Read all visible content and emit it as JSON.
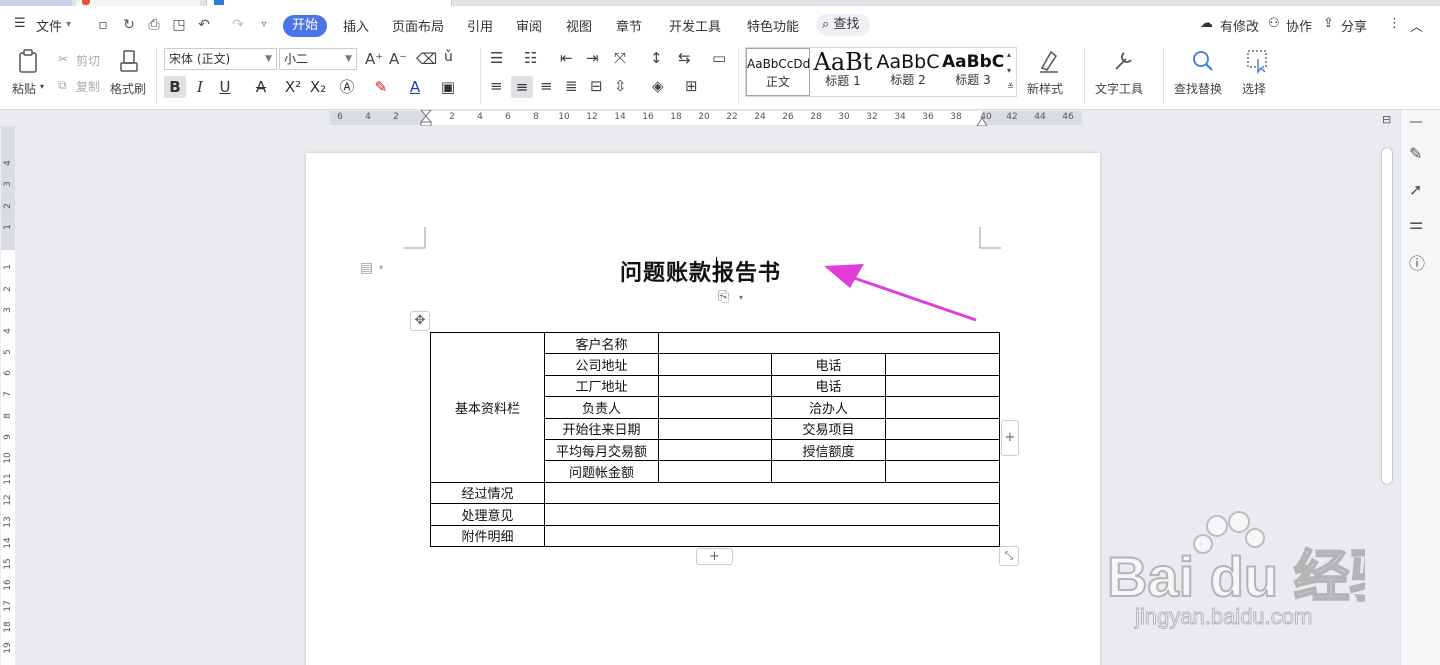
{
  "menubar": {
    "file_label": "文件",
    "tabs": [
      "开始",
      "插入",
      "页面布局",
      "引用",
      "审阅",
      "视图",
      "章节",
      "开发工具",
      "特色功能"
    ],
    "search_label": "查找",
    "right": {
      "changes": "有修改",
      "collab": "协作",
      "share": "分享"
    }
  },
  "ribbon": {
    "paste": "粘贴",
    "cut": "剪切",
    "copy": "复制",
    "format_painter": "格式刷",
    "font_name": "宋体 (正文)",
    "font_size": "小二",
    "styles": [
      {
        "sample": "AaBbCcDd",
        "label": "正文"
      },
      {
        "sample": "AaBt",
        "label": "标题 1"
      },
      {
        "sample": "AaBbC",
        "label": "标题 2"
      },
      {
        "sample": "AaBbC",
        "label": "标题 3"
      }
    ],
    "new_style": "新样式",
    "text_tools": "文字工具",
    "find_replace": "查找替换",
    "select": "选择"
  },
  "ruler": {
    "horizontal": [
      "6",
      "4",
      "2",
      "2",
      "4",
      "6",
      "8",
      "10",
      "12",
      "14",
      "16",
      "18",
      "20",
      "22",
      "24",
      "26",
      "28",
      "30",
      "32",
      "34",
      "36",
      "38",
      "40",
      "42",
      "44",
      "46"
    ],
    "vertical": [
      "4",
      "3",
      "2",
      "1",
      "1",
      "2",
      "3",
      "4",
      "5",
      "6",
      "7",
      "8",
      "9",
      "10",
      "11",
      "12",
      "13",
      "14",
      "15",
      "16",
      "17",
      "18",
      "19"
    ]
  },
  "document": {
    "title": "问题账款报告书",
    "table": {
      "section_label": "基本资料栏",
      "rows": [
        {
          "label": "客户名称"
        },
        {
          "label": "公司地址",
          "right_label": "电话"
        },
        {
          "label": "工厂地址",
          "right_label": "电话"
        },
        {
          "label": "负责人",
          "right_label": "洽办人"
        },
        {
          "label": "开始往来日期",
          "right_label": "交易项目"
        },
        {
          "label": "平均每月交易额",
          "right_label": "授信额度"
        },
        {
          "label": "问题帐金额"
        }
      ],
      "footer_rows": [
        "经过情况",
        "处理意见",
        "附件明细"
      ]
    }
  },
  "colors": {
    "accent": "#4b74e6",
    "arrow": "#e23ddb"
  },
  "watermark": {
    "brand": "Bai du 经验",
    "url": "jingyan.baidu.com"
  }
}
